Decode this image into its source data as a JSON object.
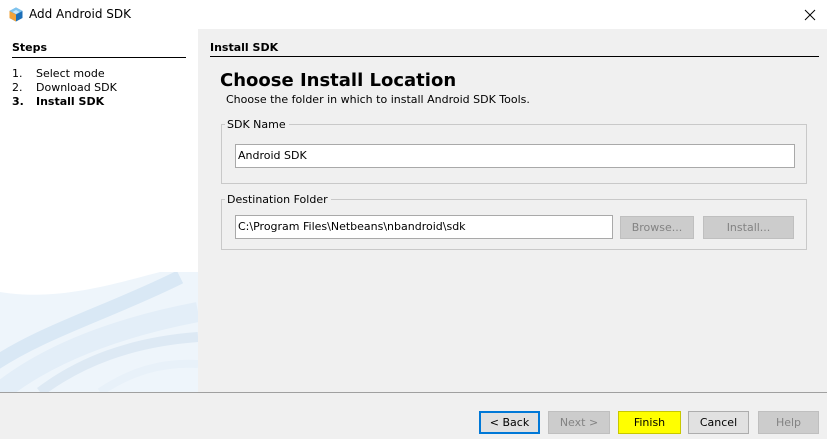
{
  "window": {
    "title": "Add Android SDK",
    "close_icon": "close-icon",
    "app_icon": "netbeans-cube-icon"
  },
  "steps": {
    "header": "Steps",
    "items": [
      {
        "num": "1.",
        "label": "Select mode",
        "current": false
      },
      {
        "num": "2.",
        "label": "Download SDK",
        "current": false
      },
      {
        "num": "3.",
        "label": "Install SDK",
        "current": true
      }
    ]
  },
  "content": {
    "section_header": "Install SDK",
    "title": "Choose Install Location",
    "subtitle": "Choose the folder in which to install Android SDK Tools.",
    "sdk_name": {
      "legend": "SDK Name",
      "value": "Android SDK"
    },
    "destination": {
      "legend": "Destination Folder",
      "value": "C:\\Program Files\\Netbeans\\nbandroid\\sdk",
      "browse_label": "Browse...",
      "install_label": "Install..."
    }
  },
  "buttons": {
    "back": "< Back",
    "next": "Next >",
    "finish": "Finish",
    "cancel": "Cancel",
    "help": "Help"
  },
  "colors": {
    "content_bg": "#f0f0f0",
    "finish_highlight": "#ffff00",
    "focus_border": "#0078d7"
  }
}
